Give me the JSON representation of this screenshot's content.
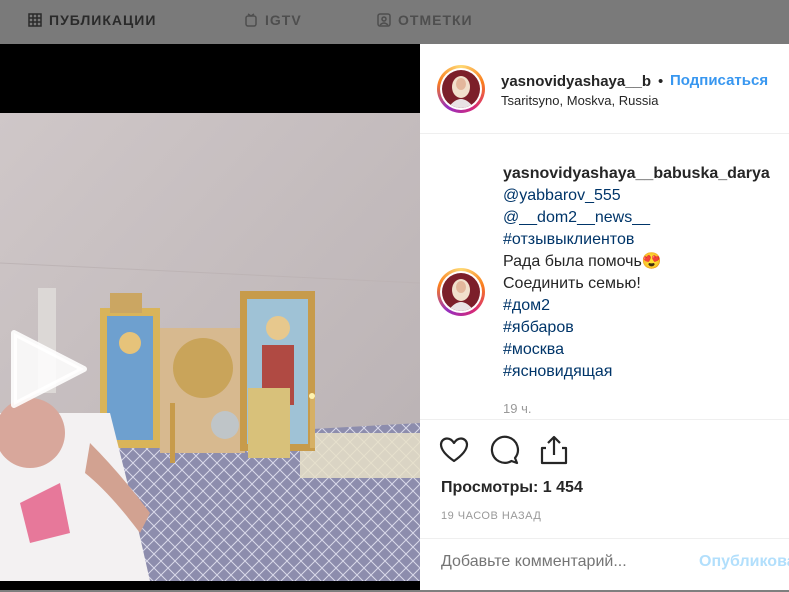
{
  "tabs": [
    {
      "label": "ПУБЛИКАЦИИ",
      "icon": "grid-icon"
    },
    {
      "label": "IGTV",
      "icon": "igtv-icon"
    },
    {
      "label": "ОТМЕТКИ",
      "icon": "tagged-icon"
    }
  ],
  "post": {
    "username": "yasnovidyashaya__babuska_darya",
    "username_truncated": "yasnovidyashaya__b",
    "separator": "•",
    "follow_label": "Подписаться",
    "location": "Tsaritsyno, Moskva, Russia"
  },
  "caption": {
    "author": "yasnovidyashaya__babuska_darya",
    "lines": [
      {
        "text": "@yabbarov_555",
        "type": "link"
      },
      {
        "text": "@__dom2__news__",
        "type": "link"
      },
      {
        "text": "#отзывыклиентов",
        "type": "link"
      },
      {
        "text": "Рада была помочь😍",
        "type": "text"
      },
      {
        "text": "Соединить семью!",
        "type": "text"
      },
      {
        "text": "#дом2",
        "type": "link"
      },
      {
        "text": "#яббаров",
        "type": "link"
      },
      {
        "text": "#москва",
        "type": "link"
      },
      {
        "text": "#ясновидящая",
        "type": "link"
      }
    ],
    "time": "19 ч."
  },
  "stats": {
    "views_label": "Просмотры:",
    "views_value": "1 454",
    "posted_ago": "19 ЧАСОВ НАЗАД"
  },
  "comment": {
    "placeholder": "Добавьте комментарий...",
    "publish_label": "Опубликовать"
  },
  "icons": [
    "heart-icon",
    "comment-icon",
    "share-icon",
    "play-icon"
  ],
  "colors": {
    "accent": "#3897f0",
    "link": "#003569",
    "muted": "#999999"
  }
}
